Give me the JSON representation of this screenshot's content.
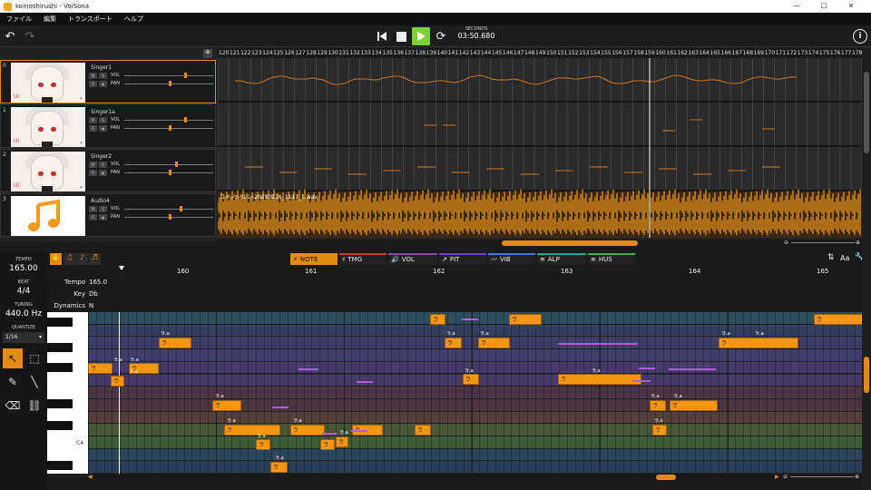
{
  "window": {
    "title": "koinoshirushi - VoiSona",
    "minimize": "—",
    "maximize": "☐",
    "close": "✕"
  },
  "menu": [
    "ファイル",
    "編集",
    "トランスポート",
    "ヘルプ"
  ],
  "transport": {
    "time_label": "SECONDS",
    "time_value": "03:50.680"
  },
  "tracks": [
    {
      "index": "0",
      "name": "Singer1",
      "vol_label": "VOL",
      "pan_label": "PAN",
      "vol": 0.67,
      "pan": 0.5,
      "selected": true,
      "thumb_caption": "Ui"
    },
    {
      "index": "1",
      "name": "Singer1a",
      "vol_label": "VOL",
      "pan_label": "PAN",
      "vol": 0.67,
      "pan": 0.5,
      "selected": false,
      "thumb_caption": "Ui"
    },
    {
      "index": "2",
      "name": "Singer2",
      "vol_label": "VOL",
      "pan_label": "PAN",
      "vol": 0.57,
      "pan": 0.5,
      "selected": false,
      "thumb_caption": "Ui"
    },
    {
      "index": "3",
      "name": "Audio4",
      "vol_label": "VOL",
      "pan_label": "PAN",
      "vol": 0.62,
      "pan": 0.5,
      "selected": false,
      "thumb_caption": ""
    }
  ],
  "audio_clip_name": "コイノシルシ-20250226_1117_1.wav",
  "ruler_top": {
    "start": 120,
    "end": 178
  },
  "lower_tabs": [
    {
      "label": "NOTE",
      "active": true,
      "color": "#e58a13"
    },
    {
      "label": "TMG",
      "active": false,
      "color": "#c0392b"
    },
    {
      "label": "VOL",
      "active": false,
      "color": "#8e44ad"
    },
    {
      "label": "PIT",
      "active": false,
      "color": "#6f3fc4"
    },
    {
      "label": "VIB",
      "active": false,
      "color": "#3d7bd6"
    },
    {
      "label": "ALP",
      "active": false,
      "color": "#1fa39c"
    },
    {
      "label": "HUS",
      "active": false,
      "color": "#3fae4f"
    }
  ],
  "left_panel": {
    "tempo_label": "TEMPO",
    "tempo": "165.00",
    "beat_label": "BEAT",
    "beat": "4/4",
    "tuning_label": "TUNING",
    "tuning": "440.0 Hz",
    "quantize_label": "QUANTIZE",
    "quantize": "1/16"
  },
  "ruler_bottom": [
    "160",
    "161",
    "162",
    "163",
    "164",
    "165"
  ],
  "info_rows": {
    "tempo_label": "Tempo",
    "tempo_value": "165.0",
    "key_label": "Key",
    "key_value": "Db",
    "dynamics_label": "Dynamics",
    "dynamics_value": "N"
  },
  "keyboard_label": "C4",
  "note_lyric": "ラ",
  "note_lyric_top": "ラ,a",
  "icons": {
    "undo": "undo-icon",
    "redo": "redo-icon",
    "skip_back": "skip-back-icon",
    "stop": "stop-icon",
    "play": "play-icon",
    "loop": "loop-icon",
    "info": "info-icon"
  }
}
